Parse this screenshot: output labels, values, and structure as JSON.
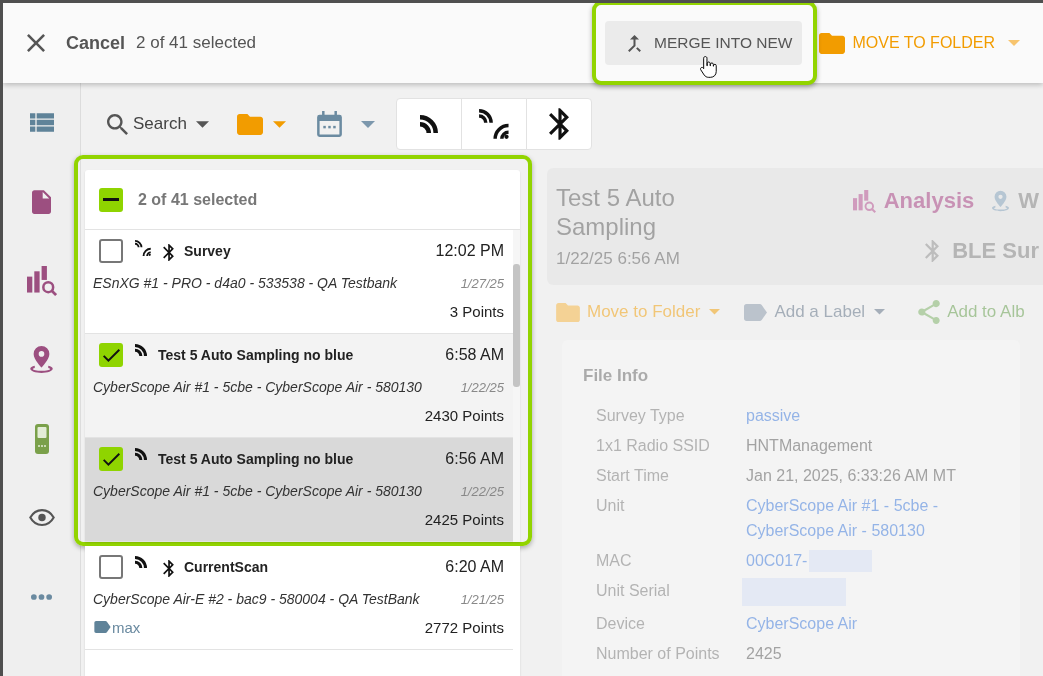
{
  "top_bar": {
    "cancel": "Cancel",
    "selection_count": "2 of 41 selected",
    "merge_button": {
      "label": "MERGE INTO NEW",
      "highlighted": true
    },
    "move_button": {
      "label": "MOVE TO FOLDER"
    }
  },
  "toolbar": {
    "search": "Search"
  },
  "list": {
    "sections": [
      {
        "highlighted": true,
        "header": {
          "selection_count": "2 of 41 selected",
          "indeterminate": true
        },
        "rows": [
          {
            "title": "Survey",
            "time": "12:02 PM",
            "unit": "ESnXG #1 - PRO - d4a0 - 533538 - QA Testbank",
            "date": "1/27/25",
            "points": "3 Points",
            "checked": false,
            "selected": false,
            "wifi": true,
            "bluetooth": true
          },
          {
            "title": "Test 5 Auto Sampling no blue",
            "time": "6:58 AM",
            "unit": "CyberScope Air #1 - 5cbe - CyberScope Air - 580130",
            "date": "1/22/25",
            "points": "2430 Points",
            "checked": true,
            "selected": false,
            "wifi": false,
            "bluetooth": false
          },
          {
            "title": "Test 5 Auto Sampling no blue",
            "time": "6:56 AM",
            "unit": "CyberScope Air #1 - 5cbe - CyberScope Air - 580130",
            "date": "1/22/25",
            "points": "2425 Points",
            "checked": true,
            "selected": true,
            "wifi": false,
            "bluetooth": false
          }
        ]
      },
      {
        "highlighted": false,
        "rows": [
          {
            "title": "CurrentScan",
            "time": "6:20 AM",
            "unit": "CyberScope Air-E #2 - bac9 - 580004 - QA TestBank",
            "date": "1/21/25",
            "labels": [
              "max"
            ],
            "points": "2772 Points",
            "checked": false,
            "selected": false,
            "wifi": false,
            "bluetooth": true
          }
        ]
      }
    ]
  },
  "detail": {
    "title": "Test 5 Auto Sampling",
    "datetime": "1/22/25 6:56 AM",
    "views": [
      {
        "kind": "chart",
        "label": "Analysis"
      },
      {
        "kind": "pin",
        "label": "W"
      },
      {
        "kind": "bluetooth",
        "label": "BLE Sur"
      }
    ],
    "actions": [
      {
        "kind": "folder",
        "label": "Move to Folder",
        "dropdown": true
      },
      {
        "kind": "label",
        "label": "Add a Label",
        "dropdown": true
      },
      {
        "kind": "share",
        "label": "Add to Alb",
        "dropdown": false
      }
    ],
    "file_info": {
      "title": "File Info",
      "fields": [
        {
          "label": "Survey Type",
          "value": "passive",
          "link": true,
          "redacted": false
        },
        {
          "label": "1x1 Radio SSID",
          "value": "HNTManagement",
          "link": false,
          "redacted": false
        },
        {
          "label": "Start Time",
          "value": "Jan 21, 2025, 6:33:26 AM MT",
          "link": false,
          "redacted": false
        },
        {
          "label": "Unit",
          "value": "CyberScope Air #1 - 5cbe - CyberScope Air - 580130",
          "link": true,
          "redacted": false
        },
        {
          "label": "MAC",
          "value": "00C017-",
          "link": true,
          "redacted": true
        },
        {
          "label": "Unit Serial",
          "redacted": true
        },
        {
          "label": "Device",
          "value": "CyberScope Air",
          "link": true,
          "redacted": false
        },
        {
          "label": "Number of Points",
          "value": "2425",
          "link": false,
          "redacted": false
        }
      ]
    }
  }
}
